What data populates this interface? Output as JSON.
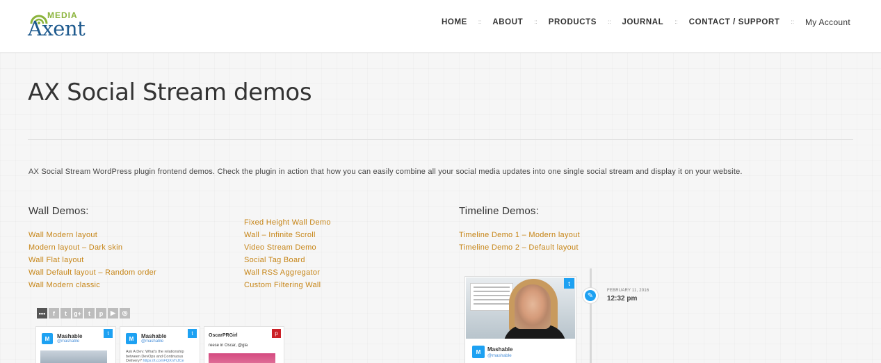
{
  "logo": {
    "media": "MEDIA",
    "name": "Axent"
  },
  "nav": {
    "items": [
      "HOME",
      "ABOUT",
      "PRODUCTS",
      "JOURNAL",
      "CONTACT / SUPPORT",
      "My Account"
    ],
    "separator": "::"
  },
  "page": {
    "title": "AX Social Stream demos",
    "intro": "AX Social Stream WordPress plugin frontend demos. Check the plugin in action that how you can easily combine all your social media updates into one single social stream and display it on your website."
  },
  "wall": {
    "heading": "Wall Demos:",
    "col1": [
      "Wall Modern layout",
      "Modern layout – Dark skin",
      "Wall Flat layout",
      "Wall Default layout – Random order",
      "Wall Modern classic"
    ],
    "col2": [
      "Fixed Height Wall Demo",
      "Wall – Infinite Scroll",
      "Video Stream Demo",
      "Social Tag Board",
      "Wall RSS Aggregator",
      "Custom Filtering Wall"
    ]
  },
  "timeline": {
    "heading": "Timeline Demos:",
    "links": [
      "Timeline Demo 1 – Modern layout",
      "Timeline Demo 2 – Default layout"
    ]
  },
  "wall_preview": {
    "share_icons": [
      "•••",
      "f",
      "t",
      "g+",
      "t",
      "p",
      "▶",
      "◎"
    ],
    "cards": [
      {
        "name": "Mashable",
        "handle": "@mashable",
        "text": "",
        "url": ""
      },
      {
        "name": "Mashable",
        "handle": "@mashable",
        "text": "Ask A Dev: What's the relationship between DevOps and Continuous Delivery?",
        "url": "https://t.co/nFQXnTrJCe"
      },
      {
        "name": "OscarPRGirl",
        "handle": "",
        "text": "reese in Oscar, @gla",
        "url": ""
      }
    ]
  },
  "timeline_preview": {
    "date": "FEBRUARY 11, 2016",
    "time": "12:32 pm",
    "name": "Mashable",
    "handle": "@mashable"
  },
  "colors": {
    "link": "#c68415",
    "twitter": "#1da1f2",
    "brand_blue": "#1e5a8e",
    "brand_green": "#8ab33a"
  },
  "icons": [
    "logo-arc-icon",
    "twitter-icon",
    "pinterest-icon",
    "edit-icon"
  ]
}
